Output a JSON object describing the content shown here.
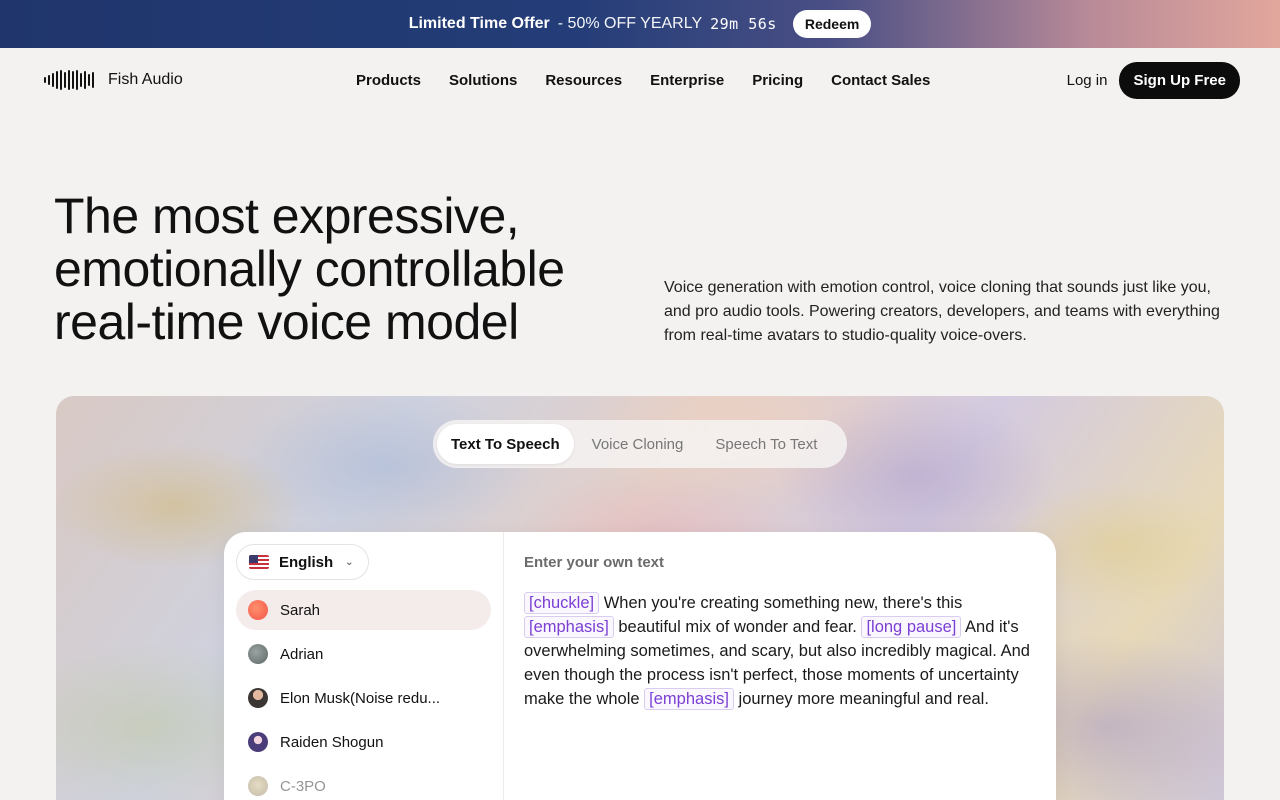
{
  "promo": {
    "title": "Limited Time Offer",
    "deal": "- 50% OFF YEARLY",
    "timer": "29m 56s",
    "redeem_label": "Redeem"
  },
  "nav": {
    "brand": "Fish Audio",
    "links": [
      "Products",
      "Solutions",
      "Resources",
      "Enterprise",
      "Pricing",
      "Contact Sales"
    ],
    "login": "Log in",
    "signup": "Sign Up Free"
  },
  "hero": {
    "title_lines": [
      "The most expressive,",
      "emotionally controllable",
      "real-time voice model"
    ],
    "subtitle": "Voice generation with emotion control, voice cloning that sounds just like you, and pro audio tools. Powering creators, developers, and teams with everything from real-time avatars to studio-quality voice-overs."
  },
  "tabs": [
    {
      "label": "Text To Speech",
      "active": true
    },
    {
      "label": "Voice Cloning",
      "active": false
    },
    {
      "label": "Speech To Text",
      "active": false
    }
  ],
  "demo": {
    "language": "English",
    "voices": [
      {
        "name": "Sarah",
        "icon": "sarah-avatar"
      },
      {
        "name": "Adrian",
        "icon": "adrian-avatar"
      },
      {
        "name": "Elon Musk(Noise redu...",
        "icon": "elon-avatar"
      },
      {
        "name": "Raiden Shogun",
        "icon": "raiden-avatar"
      },
      {
        "name": "C-3PO",
        "icon": "c3po-avatar"
      }
    ],
    "prompt_label": "Enter your own text",
    "text_parts": [
      {
        "tag": "[chuckle]"
      },
      {
        "text": " When you're creating something new, there's this "
      },
      {
        "tag": "[emphasis]"
      },
      {
        "text": " beautiful mix of wonder and fear. "
      },
      {
        "tag": "[long pause]"
      },
      {
        "text": " And it's overwhelming sometimes, and scary, but also incredibly magical. And even though the process isn't perfect, those moments of uncertainty make the whole "
      },
      {
        "tag": "[emphasis]"
      },
      {
        "text": " journey more meaningful and real."
      }
    ]
  }
}
